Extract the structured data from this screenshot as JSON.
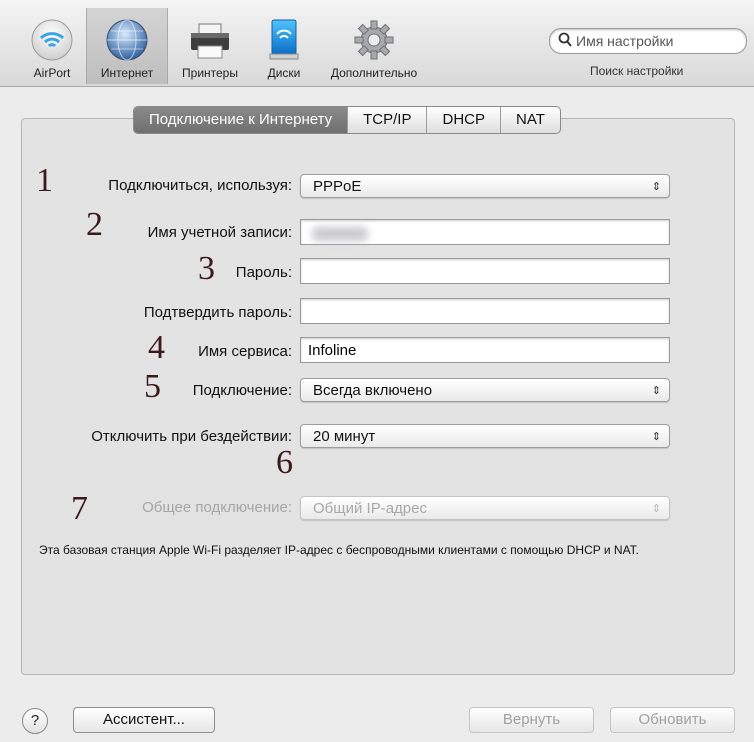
{
  "toolbar": {
    "items": [
      {
        "label": "AirPort",
        "icon": "wifi-icon"
      },
      {
        "label": "Интернет",
        "icon": "globe-icon",
        "selected": true
      },
      {
        "label": "Принтеры",
        "icon": "printer-icon"
      },
      {
        "label": "Диски",
        "icon": "disk-icon"
      },
      {
        "label": "Дополнительно",
        "icon": "gear-icon"
      }
    ],
    "search_placeholder": "Имя настройки",
    "search_label": "Поиск настройки"
  },
  "tabs": [
    "Подключение к Интернету",
    "TCP/IP",
    "DHCP",
    "NAT"
  ],
  "annotations": [
    "1",
    "2",
    "3",
    "4",
    "5",
    "6",
    "7"
  ],
  "form": {
    "connect_using": {
      "label": "Подключиться, используя:",
      "value": "PPPoE"
    },
    "account_name": {
      "label": "Имя учетной записи:",
      "value": ""
    },
    "password": {
      "label": "Пароль:",
      "value": ""
    },
    "confirm_password": {
      "label": "Подтвердить пароль:",
      "value": ""
    },
    "service_name": {
      "label": "Имя сервиса:",
      "value": "Infoline"
    },
    "connection": {
      "label": "Подключение:",
      "value": "Всегда включено"
    },
    "disconnect_idle": {
      "label": "Отключить при бездействии:",
      "value": "20 минут"
    },
    "sharing": {
      "label": "Общее подключение:",
      "value": "Общий IP-адрес"
    }
  },
  "note": "Эта базовая станция Apple Wi-Fi разделяет IP-адрес с беспроводными клиентами с помощью DHCP и NAT.",
  "buttons": {
    "help": "?",
    "assistant": "Ассистент...",
    "revert": "Вернуть",
    "update": "Обновить"
  },
  "colors": {
    "annotation": "#3a1a1a",
    "tab_active": "#7b7b7b",
    "accent": "#3a8fd8"
  }
}
